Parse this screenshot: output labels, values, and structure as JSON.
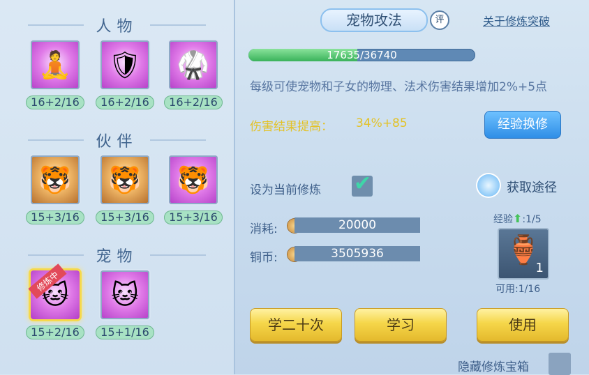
{
  "left": {
    "sections": [
      {
        "title": "人物",
        "slots": [
          {
            "level": "16+2/16",
            "icon": "warrior-meditate-icon"
          },
          {
            "level": "16+2/16",
            "icon": "warrior-shield-icon"
          },
          {
            "level": "16+2/16",
            "icon": "warrior-armor-icon"
          }
        ]
      },
      {
        "title": "伙伴",
        "slots": [
          {
            "level": "15+3/16",
            "icon": "partner-attack-icon"
          },
          {
            "level": "15+3/16",
            "icon": "partner-defense-icon"
          },
          {
            "level": "15+3/16",
            "icon": "partner-magic-icon"
          }
        ]
      },
      {
        "title": "宠物",
        "slots": [
          {
            "level": "15+2/16",
            "icon": "pet-attack-icon",
            "ribbon": "修炼中"
          },
          {
            "level": "15+1/16",
            "icon": "pet-defense-icon"
          }
        ]
      }
    ]
  },
  "main": {
    "tab_title": "宠物攻法",
    "rate_label": "评",
    "about_link": "关于修炼突破",
    "xp": {
      "current": 17635,
      "max": 36740,
      "text": "17635/36740",
      "fraction": 0.48
    },
    "description": "每级可使宠物和子女的物理、法术伤害结果增加2%+5点",
    "effect_label": "伤害结果提高：",
    "effect_value": "34%+85",
    "exchange_button": "经验换修",
    "set_current_label": "设为当前修炼",
    "set_current_checked": true,
    "get_way_label": "获取途径",
    "cost_label": "消耗:",
    "cost_value": "20000",
    "coin_label": "铜币:",
    "coin_value": "3505936",
    "exp_label": "经验",
    "exp_count": ":1/5",
    "item_count": "1",
    "avail_label": "可用:1/16",
    "buttons": {
      "learn20": "学二十次",
      "learn": "学习",
      "use": "使用"
    },
    "hide_label": "隐藏修炼宝箱"
  },
  "colors": {
    "accent_blue": "#2f8ee6",
    "gold": "#f5d649",
    "effect": "#e3c227",
    "xp_fill": "#39b25a"
  }
}
